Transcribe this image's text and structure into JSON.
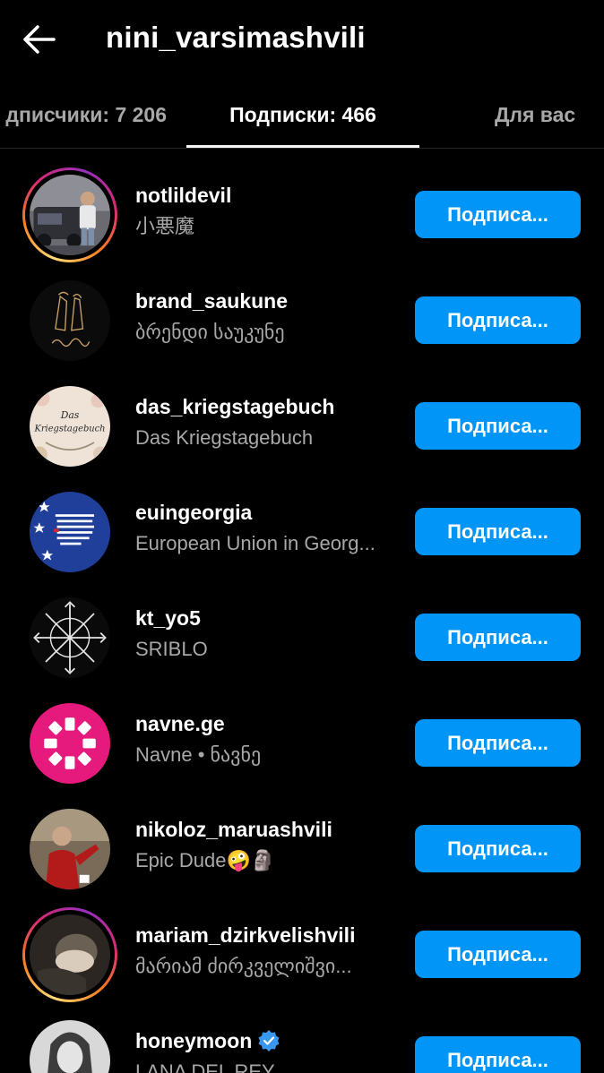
{
  "header": {
    "title": "nini_varsimashvili",
    "back_icon": "arrow-left-icon"
  },
  "tabs": [
    {
      "label": "дписчики: 7 206",
      "active": false
    },
    {
      "label": "Подписки: 466",
      "active": true
    },
    {
      "label": "Для вас",
      "active": false
    }
  ],
  "accounts": [
    {
      "username": "notlildevil",
      "fullname": "小悪魔",
      "button": "Подписа...",
      "story_ring": true,
      "verified": false
    },
    {
      "username": "brand_saukune",
      "fullname": "ბრენდი საუკუნე",
      "button": "Подписа...",
      "story_ring": false,
      "verified": false
    },
    {
      "username": "das_kriegstagebuch",
      "fullname": "Das Kriegstagebuch",
      "button": "Подписа...",
      "story_ring": false,
      "verified": false,
      "avatar_text": [
        "Das",
        "Kriegstagebuch"
      ]
    },
    {
      "username": "euingeorgia",
      "fullname": "European Union in Georg...",
      "button": "Подписа...",
      "story_ring": false,
      "verified": false
    },
    {
      "username": "kt_yo5",
      "fullname": "SRIBLO",
      "button": "Подписа...",
      "story_ring": false,
      "verified": false
    },
    {
      "username": "navne.ge",
      "fullname": "Navne • ნავნე",
      "button": "Подписа...",
      "story_ring": false,
      "verified": false
    },
    {
      "username": "nikoloz_maruashvili",
      "fullname": "Epic Dude🤪🗿",
      "button": "Подписа...",
      "story_ring": false,
      "verified": false
    },
    {
      "username": "mariam_dzirkvelishvili",
      "fullname": "მარიამ ძირკველიშვი...",
      "button": "Подписа...",
      "story_ring": true,
      "verified": false
    },
    {
      "username": "honeymoon",
      "fullname": "LANA DEL REY",
      "button": "Подписа...",
      "story_ring": false,
      "verified": true
    }
  ],
  "colors": {
    "background": "#000000",
    "button": "#0095f6",
    "secondary_text": "#a8a8a8",
    "verified": "#3897f0"
  }
}
